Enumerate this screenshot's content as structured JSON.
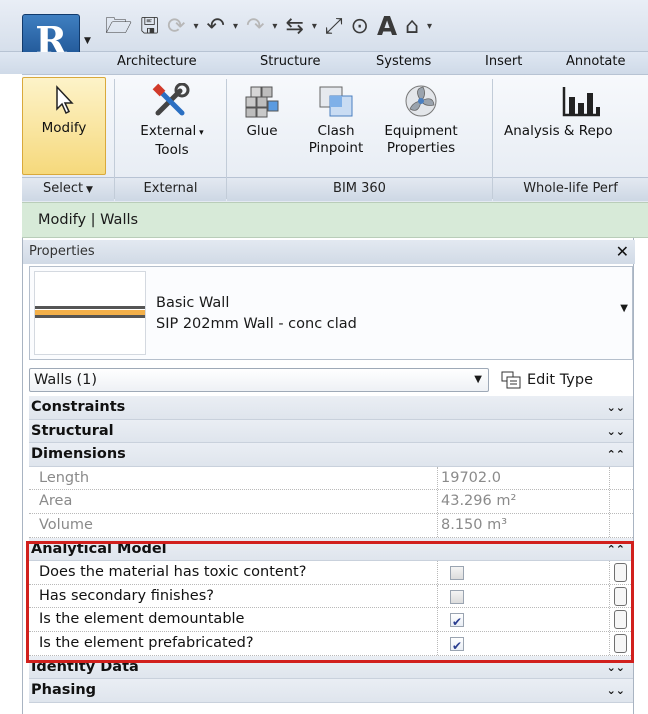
{
  "colors": {
    "context_bar": "#d7ead8",
    "highlight": "#d1201d",
    "app_button": "#2a62a6",
    "modify_active": "#f6d97c"
  },
  "app_button": {
    "letter": "R",
    "icon": "revit-app-icon"
  },
  "quick_access": {
    "icons": [
      "open-folder-icon",
      "save-icon",
      "sync-icon",
      "undo-icon",
      "redo-icon",
      "measure-icon",
      "dimension-icon",
      "tag-icon",
      "text-icon",
      "3d-view-icon"
    ],
    "text_tool_label": "A"
  },
  "ribbon_tabs": [
    "Architecture",
    "Structure",
    "Systems",
    "Insert",
    "Annotate"
  ],
  "ribbon": {
    "modify": {
      "label": "Modify",
      "icon": "cursor-arrow-icon"
    },
    "external_tools": {
      "label_line1": "External",
      "label_line2": "Tools",
      "icon": "wrench-screwdriver-icon"
    },
    "glue": {
      "label": "Glue",
      "icon": "glue-blocks-icon"
    },
    "clash_pinpoint": {
      "label_line1": "Clash",
      "label_line2": "Pinpoint",
      "icon": "clash-squares-icon"
    },
    "equipment_properties": {
      "label_line1": "Equipment",
      "label_line2": "Properties",
      "icon": "fan-icon"
    },
    "analysis": {
      "label": "Analysis & Repo",
      "icon": "bar-chart-icon"
    },
    "groups": {
      "select": "Select",
      "external": "External",
      "bim360": "BIM 360",
      "whole_life": "Whole-life Perf"
    }
  },
  "context_bar": {
    "text": "Modify | Walls"
  },
  "properties": {
    "title": "Properties",
    "type_selector": {
      "family": "Basic Wall",
      "type": "SIP 202mm Wall - conc clad"
    },
    "instance_filter": "Walls (1)",
    "edit_type_label": "Edit Type",
    "categories": {
      "constraints": "Constraints",
      "structural": "Structural",
      "dimensions": "Dimensions",
      "analytical_model": "Analytical Model",
      "identity_data": "Identity Data",
      "phasing": "Phasing"
    },
    "dimensions": [
      {
        "label": "Length",
        "value": "19702.0"
      },
      {
        "label": "Area",
        "value": "43.296 m²"
      },
      {
        "label": "Volume",
        "value": "8.150 m³"
      }
    ],
    "analytical_params": [
      {
        "label": "Does the material has toxic content?",
        "checked": false
      },
      {
        "label": "Has secondary finishes?",
        "checked": false
      },
      {
        "label": "Is the element demountable",
        "checked": true
      },
      {
        "label": "Is the element prefabricated?",
        "checked": true
      }
    ]
  }
}
